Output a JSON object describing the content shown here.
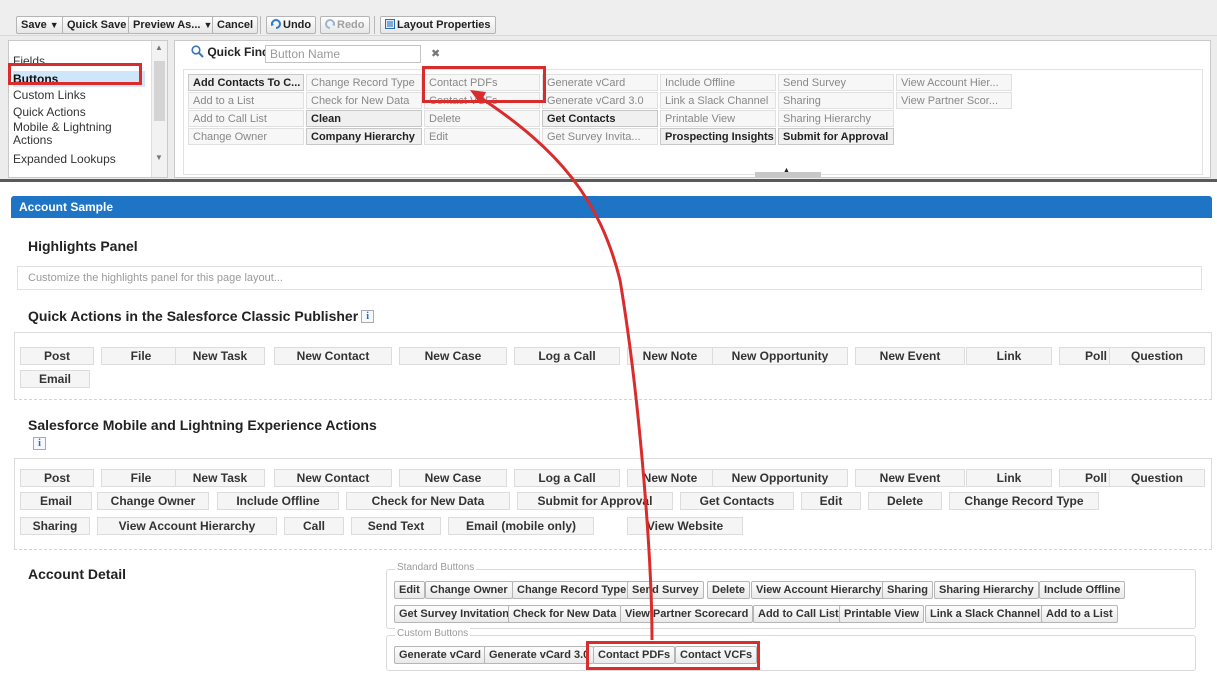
{
  "toolbar": {
    "save": "Save",
    "quick_save": "Quick Save",
    "preview_as": "Preview As...",
    "cancel": "Cancel",
    "undo": "Undo",
    "redo": "Redo",
    "layout_properties": "Layout Properties"
  },
  "categories": [
    "Fields",
    "Buttons",
    "Custom Links",
    "Quick Actions",
    "Mobile & Lightning Actions",
    "Expanded Lookups"
  ],
  "quick_find": {
    "label": "Quick Find",
    "placeholder": "Button Name"
  },
  "palette_columns": [
    [
      "Add Contacts To C...",
      "Add to a List",
      "Add to Call List",
      "Change Owner"
    ],
    [
      "Change Record Type",
      "Check for New Data",
      "Clean",
      "Company Hierarchy"
    ],
    [
      "Contact PDFs",
      "Contact VCFs",
      "Delete",
      "Edit"
    ],
    [
      "Generate vCard",
      "Generate vCard 3.0",
      "Get Contacts",
      "Get Survey Invita..."
    ],
    [
      "Include Offline",
      "Link a Slack Channel",
      "Printable View",
      "Prospecting Insights"
    ],
    [
      "Send Survey",
      "Sharing",
      "Sharing Hierarchy",
      "Submit for Approval"
    ],
    [
      "View Account Hier...",
      "View Partner Scor..."
    ]
  ],
  "layout": {
    "title": "Account Sample",
    "highlights_title": "Highlights Panel",
    "highlights_placeholder": "Customize the highlights panel for this page layout...",
    "classic_title": "Quick Actions in the Salesforce Classic Publisher",
    "classic_actions": [
      "Post",
      "File",
      "New Task",
      "New Contact",
      "New Case",
      "Log a Call",
      "New Note",
      "New Opportunity",
      "New Event",
      "Link",
      "Poll",
      "Question",
      "Email"
    ],
    "mobile_title": "Salesforce Mobile and Lightning Experience Actions",
    "mobile_actions": [
      "Post",
      "File",
      "New Task",
      "New Contact",
      "New Case",
      "Log a Call",
      "New Note",
      "New Opportunity",
      "New Event",
      "Link",
      "Poll",
      "Question",
      "Email",
      "Change Owner",
      "Include Offline",
      "Check for New Data",
      "Submit for Approval",
      "Get Contacts",
      "Edit",
      "Delete",
      "Change Record Type",
      "Sharing",
      "View Account Hierarchy",
      "Call",
      "Send Text",
      "Email (mobile only)",
      "View Website"
    ],
    "detail_title": "Account Detail",
    "standard_legend": "Standard Buttons",
    "standard_buttons": [
      "Edit",
      "Change Owner",
      "Change Record Type",
      "Send Survey",
      "Delete",
      "View Account Hierarchy",
      "Sharing",
      "Sharing Hierarchy",
      "Include Offline",
      "Get Survey Invitation",
      "Check for New Data",
      "View Partner Scorecard",
      "Add to Call List",
      "Printable View",
      "Link a Slack Channel",
      "Add to a List"
    ],
    "custom_legend": "Custom Buttons",
    "custom_buttons": [
      "Generate vCard",
      "Generate vCard 3.0",
      "Contact PDFs",
      "Contact VCFs"
    ]
  },
  "colors": {
    "highlight": "#d92c2c",
    "header": "#1e74c5"
  }
}
